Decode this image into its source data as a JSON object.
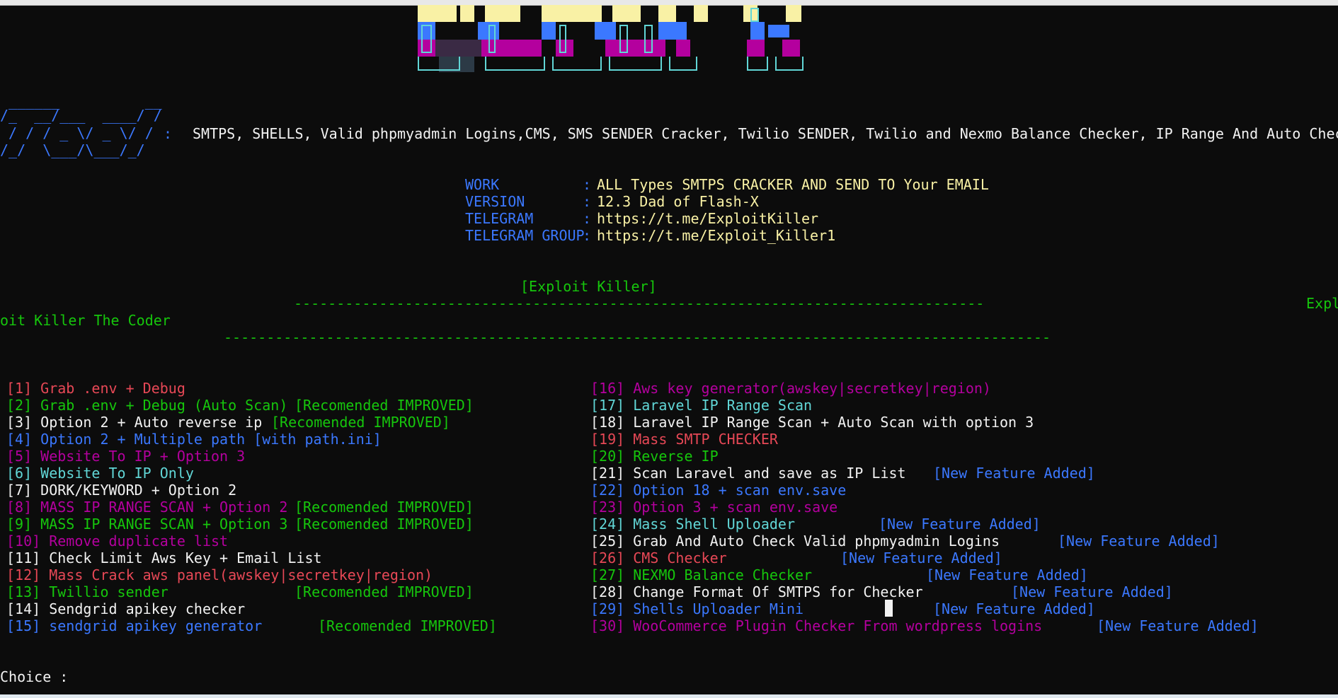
{
  "colors": {
    "background": "#0c0c0c",
    "red": "#e74856",
    "green": "#16c60c",
    "white": "#f2f2f2",
    "blue": "#3b78ff",
    "magenta": "#b4009e",
    "cyan": "#61d6d6",
    "yellow": "#f9f1a5"
  },
  "logo": {
    "line1": " ______          __",
    "line2": "/_  __/___  ____/ /",
    "line3": " / / / _ \\/ _ \\/ / ",
    "line4": "/_/  \\___/\\___/_/  ",
    "separator": ":",
    "tagline": "SMTPS, SHELLS, Valid phpmyadmin Logins,CMS, SMS SENDER Cracker, Twilio SENDER, Twilio and Nexmo Balance Checker, IP Range And Auto Checker"
  },
  "info": [
    {
      "key": "WORK",
      "sep": ":",
      "value": "ALL Types SMTPS CRACKER AND SEND TO Your EMAIL"
    },
    {
      "key": "VERSION",
      "sep": ":",
      "value": "12.3 Dad of Flash-X"
    },
    {
      "key": "TELEGRAM",
      "sep": ":",
      "value": "https://t.me/ExploitKiller"
    },
    {
      "key": "TELEGRAM GROUP",
      "sep": ":",
      "value": "https://t.me/Exploit_Killer1"
    }
  ],
  "credits": {
    "title": "[Exploit Killer]",
    "dashes1": "---------------------------------------------------------------------------------",
    "right_fragment": "Expl",
    "wrapped": "oit Killer The Coder",
    "dashes2": "-------------------------------------------------------------------------------------------------"
  },
  "menu_left": [
    {
      "num": "[1]",
      "label": "Grab .env + Debug",
      "tag": ""
    },
    {
      "num": "[2]",
      "label": "Grab .env + Debug (Auto Scan)",
      "tag": "[Recomended IMPROVED]"
    },
    {
      "num": "[3]",
      "label": "Option 2 + Auto reverse ip",
      "tag": "[Recomended IMPROVED]"
    },
    {
      "num": "[4]",
      "label": "Option 2 + Multiple path [with path.ini]",
      "tag": ""
    },
    {
      "num": "[5]",
      "label": "Website To IP + Option 3",
      "tag": ""
    },
    {
      "num": "[6]",
      "label": "Website To IP Only",
      "tag": ""
    },
    {
      "num": "[7]",
      "label": "DORK/KEYWORD + Option 2",
      "tag": ""
    },
    {
      "num": "[8]",
      "label": "MASS IP RANGE SCAN + Option 2",
      "tag": "[Recomended IMPROVED]"
    },
    {
      "num": "[9]",
      "label": "MASS IP RANGE SCAN + Option 3",
      "tag": "[Recomended IMPROVED]"
    },
    {
      "num": "[10]",
      "label": "Remove duplicate list",
      "tag": ""
    },
    {
      "num": "[11]",
      "label": "Check Limit Aws Key + Email List",
      "tag": ""
    },
    {
      "num": "[12]",
      "label": "Mass Crack aws panel(awskey|secretkey|region)",
      "tag": ""
    },
    {
      "num": "[13]",
      "label": "Twillio sender",
      "tag": "[Recomended IMPROVED]"
    },
    {
      "num": "[14]",
      "label": "Sendgrid apikey checker",
      "tag": ""
    },
    {
      "num": "[15]",
      "label": "sendgrid apikey generator",
      "tag": "[Recomended IMPROVED]"
    }
  ],
  "menu_right": [
    {
      "num": "[16]",
      "label": "Aws key generator(awskey|secretkey|region)",
      "tag": ""
    },
    {
      "num": "[17]",
      "label": "Laravel IP Range Scan",
      "tag": ""
    },
    {
      "num": "[18]",
      "label": "Laravel IP Range Scan + Auto Scan with option 3",
      "tag": ""
    },
    {
      "num": "[19]",
      "label": "Mass SMTP CHECKER",
      "tag": ""
    },
    {
      "num": "[20]",
      "label": "Reverse IP",
      "tag": ""
    },
    {
      "num": "[21]",
      "label": "Scan Laravel and save as IP List",
      "tag": "[New Feature Added]"
    },
    {
      "num": "[22]",
      "label": "Option 18 + scan env.save",
      "tag": ""
    },
    {
      "num": "[23]",
      "label": "Option 3 + scan env.save",
      "tag": ""
    },
    {
      "num": "[24]",
      "label": "Mass Shell Uploader",
      "tag": "[New Feature Added]"
    },
    {
      "num": "[25]",
      "label": "Grab And Auto Check Valid phpmyadmin Logins",
      "tag": "[New Feature Added]"
    },
    {
      "num": "[26]",
      "label": "CMS Checker",
      "tag": "[New Feature Added]"
    },
    {
      "num": "[27]",
      "label": "NEXMO Balance Checker",
      "tag": "[New Feature Added]"
    },
    {
      "num": "[28]",
      "label": "Change Format Of SMTPS for Checker",
      "tag": "[New Feature Added]"
    },
    {
      "num": "[29]",
      "label": "Shells Uploader Mini",
      "tag": "[New Feature Added]"
    },
    {
      "num": "[30]",
      "label": "WooCommerce Plugin Checker From wordpress logins",
      "tag": "[New Feature Added]"
    }
  ],
  "prompt": {
    "label": "Choice :",
    "value": ""
  }
}
